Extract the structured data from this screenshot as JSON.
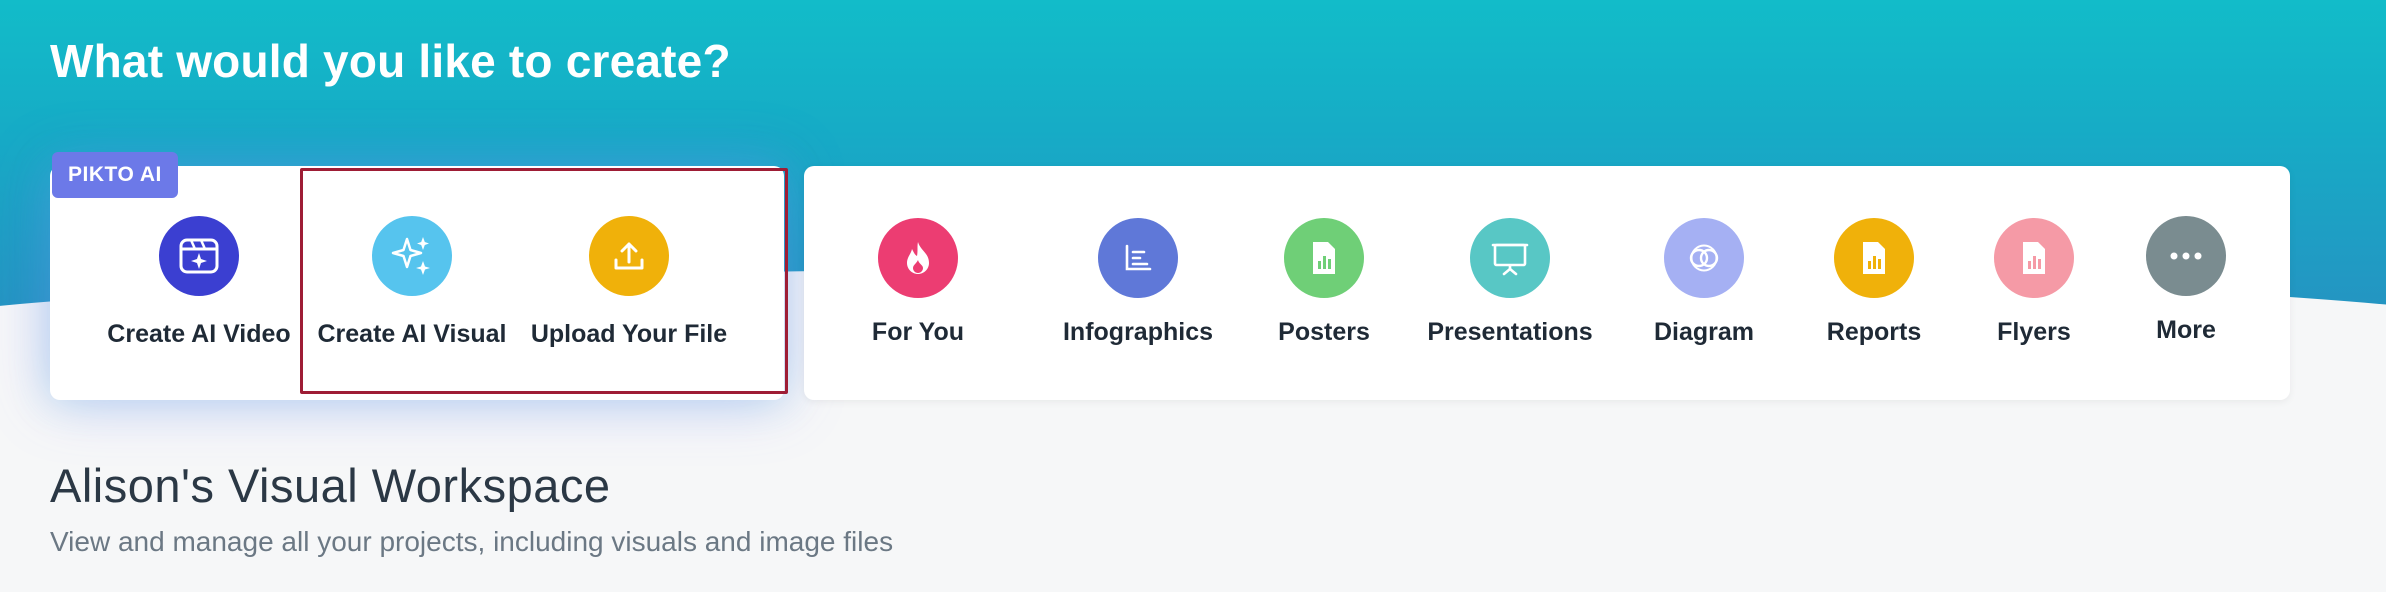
{
  "header": {
    "title": "What would you like to create?"
  },
  "ai_section": {
    "badge": "PIKTO AI",
    "items": [
      {
        "label": "Create AI Video",
        "icon": "video-sparkle-icon",
        "color": "#3b3fd1"
      },
      {
        "label": "Create AI Visual",
        "icon": "sparkles-icon",
        "color": "#56c4ee"
      },
      {
        "label": "Upload Your File",
        "icon": "upload-icon",
        "color": "#f0b10a"
      }
    ]
  },
  "categories": [
    {
      "label": "For You",
      "icon": "flame-icon",
      "color": "#ec3d72"
    },
    {
      "label": "Infographics",
      "icon": "infographic-icon",
      "color": "#5f78d8"
    },
    {
      "label": "Posters",
      "icon": "poster-icon",
      "color": "#6fcf77"
    },
    {
      "label": "Presentations",
      "icon": "presentation-icon",
      "color": "#58c7c5"
    },
    {
      "label": "Diagram",
      "icon": "diagram-icon",
      "color": "#a5b0f3"
    },
    {
      "label": "Reports",
      "icon": "report-icon",
      "color": "#f0b10a"
    },
    {
      "label": "Flyers",
      "icon": "flyer-icon",
      "color": "#f59aa6"
    },
    {
      "label": "More",
      "icon": "more-icon",
      "color": "#7a8c90"
    }
  ],
  "workspace": {
    "title": "Alison's Visual Workspace",
    "subtitle": "View and manage all your projects, including visuals and image files"
  }
}
